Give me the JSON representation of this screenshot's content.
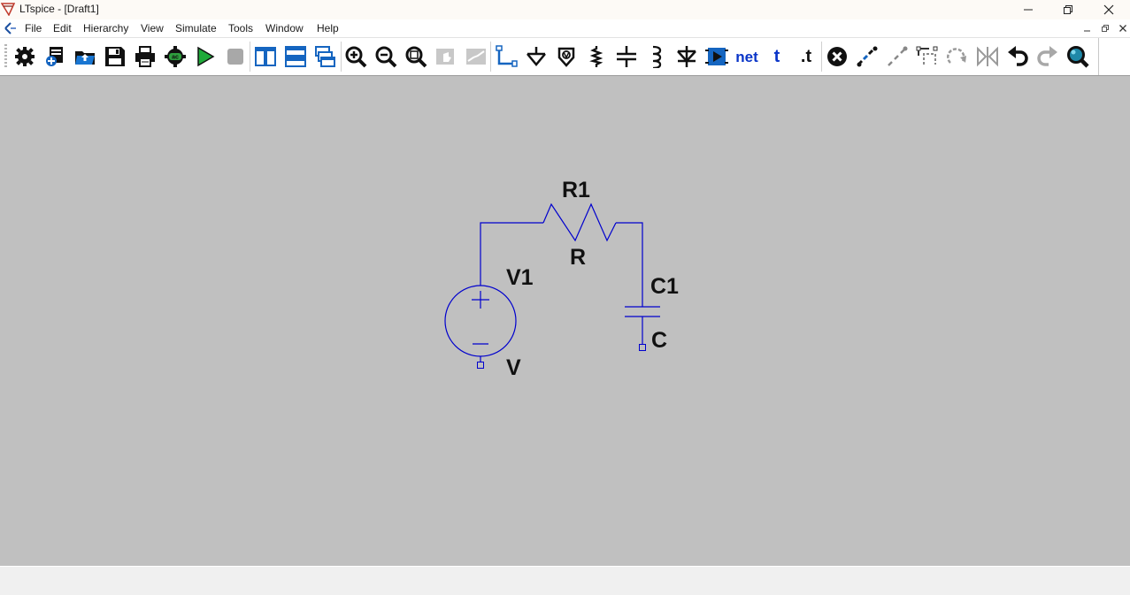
{
  "window": {
    "title": "LTspice - [Draft1]",
    "controls": [
      "minimize",
      "restore",
      "close"
    ]
  },
  "menu": {
    "items": [
      "File",
      "Edit",
      "Hierarchy",
      "View",
      "Simulate",
      "Tools",
      "Window",
      "Help"
    ]
  },
  "toolbar": {
    "buttons": [
      {
        "icon": "settings-gear-icon"
      },
      {
        "icon": "new-schematic-icon"
      },
      {
        "icon": "open-file-icon"
      },
      {
        "icon": "save-icon"
      },
      {
        "icon": "print-icon"
      },
      {
        "icon": "control-panel-ac-icon"
      },
      {
        "icon": "run-icon"
      },
      {
        "icon": "halt-icon"
      },
      {
        "icon": "tile-vertical-icon"
      },
      {
        "icon": "tile-horizontal-icon"
      },
      {
        "icon": "cascade-windows-icon"
      },
      {
        "icon": "zoom-in-icon"
      },
      {
        "icon": "zoom-out-icon"
      },
      {
        "icon": "zoom-fit-icon"
      },
      {
        "icon": "pan-icon"
      },
      {
        "icon": "autorange-icon"
      },
      {
        "icon": "wire-icon"
      },
      {
        "icon": "ground-icon"
      },
      {
        "icon": "voltage-source-icon"
      },
      {
        "icon": "resistor-icon"
      },
      {
        "icon": "capacitor-icon"
      },
      {
        "icon": "inductor-icon"
      },
      {
        "icon": "diode-icon"
      },
      {
        "icon": "component-icon"
      },
      {
        "icon": "net-label-icon",
        "label": "net"
      },
      {
        "icon": "text-icon",
        "label": "t"
      },
      {
        "icon": "spice-directive-icon",
        "label": ".t"
      },
      {
        "icon": "delete-icon"
      },
      {
        "icon": "duplicate-icon"
      },
      {
        "icon": "move-icon"
      },
      {
        "icon": "drag-icon"
      },
      {
        "icon": "rotate-icon"
      },
      {
        "icon": "mirror-icon"
      },
      {
        "icon": "undo-icon"
      },
      {
        "icon": "redo-icon"
      },
      {
        "icon": "find-icon"
      }
    ]
  },
  "schematic": {
    "labels": {
      "r1_name": "R1",
      "r1_value": "R",
      "v1_name": "V1",
      "v1_value": "V",
      "c1_name": "C1",
      "c1_value": "C"
    },
    "colors": {
      "wire": "#0000cd",
      "background": "#c0c0c0",
      "label": "#111111"
    }
  }
}
